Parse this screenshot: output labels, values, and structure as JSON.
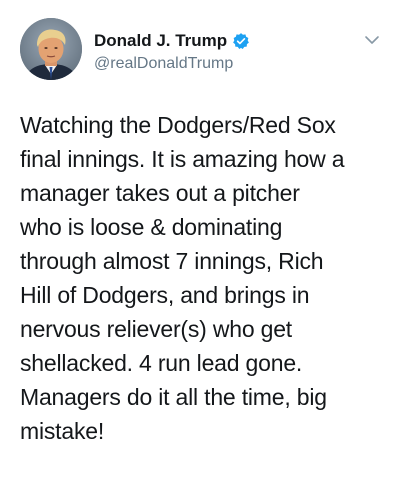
{
  "user": {
    "display_name": "Donald J. Trump",
    "handle": "@realDonaldTrump",
    "verified": true
  },
  "tweet": {
    "lines": [
      "Watching the Dodgers/Red Sox",
      "final innings. It is amazing how a",
      "manager takes out a pitcher",
      "who is loose & dominating",
      "through almost 7 innings, Rich",
      "Hill of Dodgers, and brings in",
      "nervous reliever(s) who get",
      "shellacked. 4 run lead gone.",
      "Managers do it all the time, big",
      "mistake!"
    ]
  },
  "icons": {
    "verified": "verified-badge-icon",
    "menu": "chevron-down-icon"
  },
  "colors": {
    "verified_blue": "#1da1f2",
    "text": "#14171a",
    "secondary_text": "#657786"
  }
}
